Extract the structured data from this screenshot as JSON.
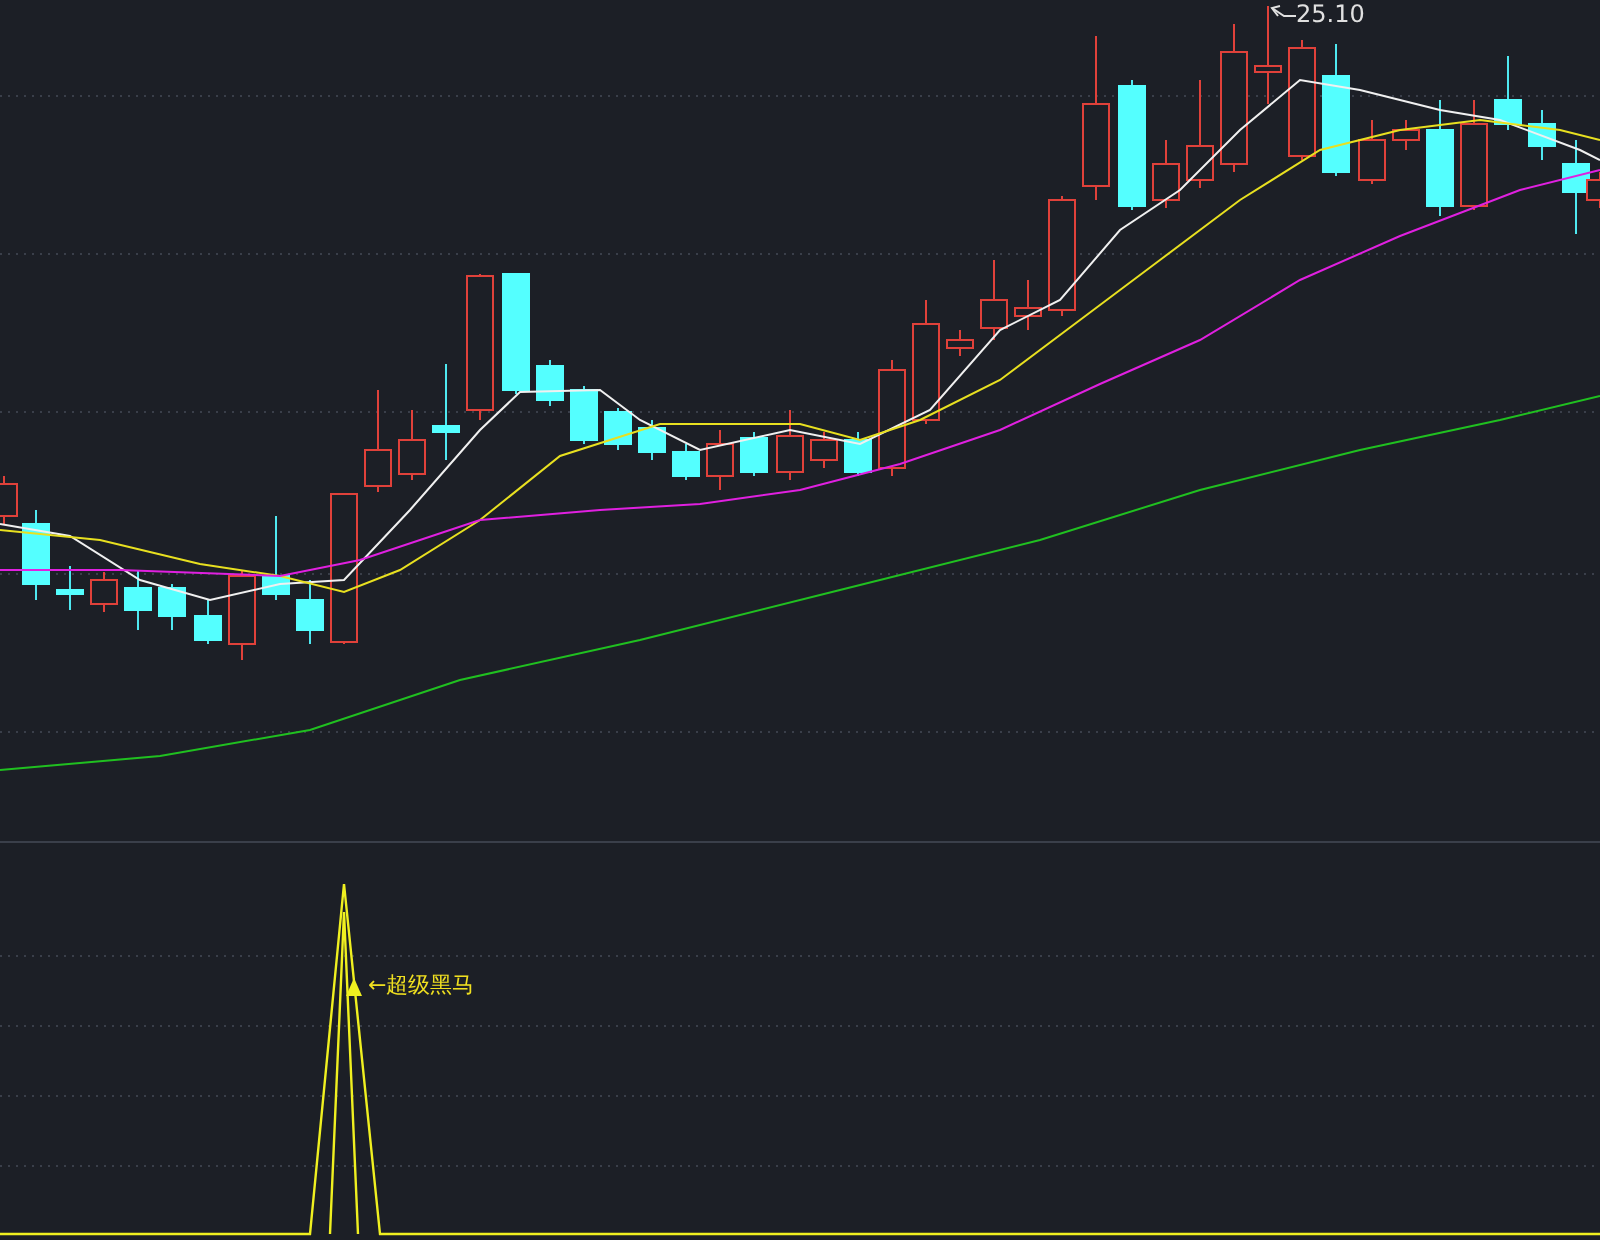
{
  "price_chart": {
    "high_label": "25.10"
  },
  "signal_panel": {
    "label": "←超级黑马"
  }
}
